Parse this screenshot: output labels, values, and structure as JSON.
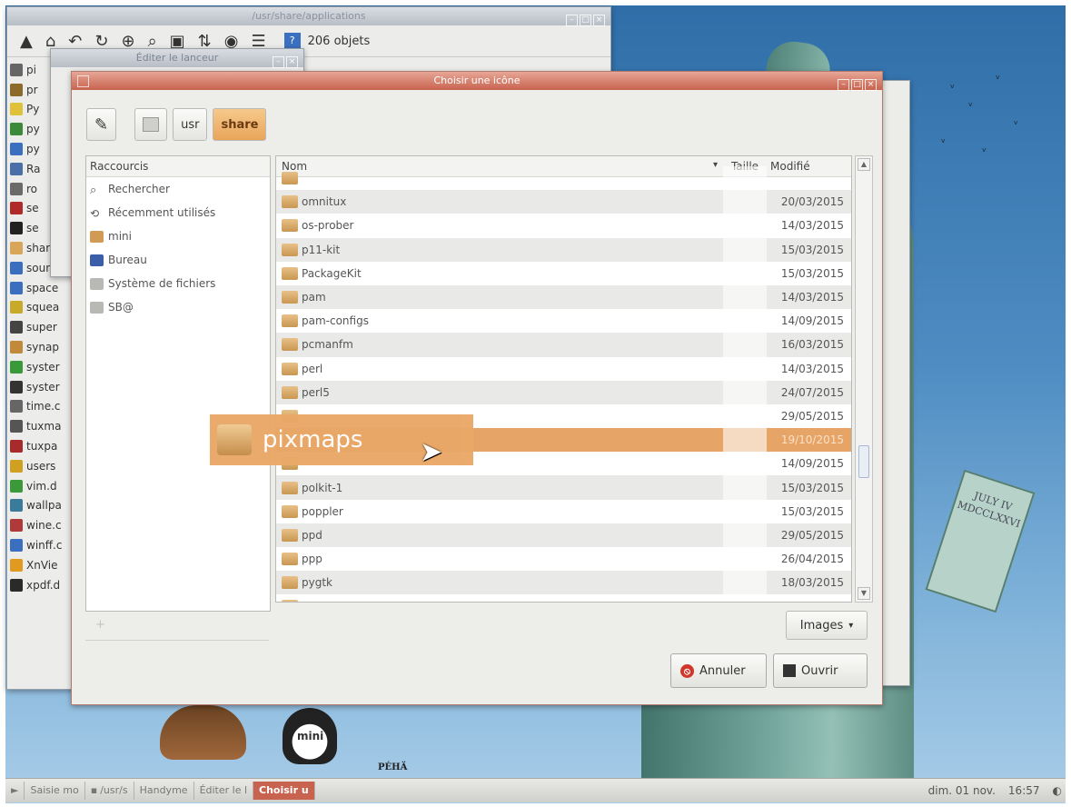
{
  "file_manager": {
    "title": "/usr/share/applications",
    "count_badge": "?",
    "count": "206 objets",
    "items": [
      {
        "label": "pi",
        "color": "#666"
      },
      {
        "label": "pr",
        "color": "#8b6a2a"
      },
      {
        "label": "Py",
        "color": "#e0c23a"
      },
      {
        "label": "py",
        "color": "#3a8a3a"
      },
      {
        "label": "py",
        "color": "#3a6fc0"
      },
      {
        "label": "Ra",
        "color": "#4a6ea8"
      },
      {
        "label": "ro",
        "color": "#6a6a6a"
      },
      {
        "label": "se",
        "color": "#b02a2a"
      },
      {
        "label": "se",
        "color": "#222"
      },
      {
        "label": "share",
        "color": "#d8a55a"
      },
      {
        "label": "sounc",
        "color": "#3a6fc0"
      },
      {
        "label": "space",
        "color": "#3a6fc0"
      },
      {
        "label": "squea",
        "color": "#c9a92a"
      },
      {
        "label": "super",
        "color": "#444"
      },
      {
        "label": "synap",
        "color": "#c08a3a"
      },
      {
        "label": "syster",
        "color": "#3a9a3a"
      },
      {
        "label": "syster",
        "color": "#333"
      },
      {
        "label": "time.c",
        "color": "#666"
      },
      {
        "label": "tuxma",
        "color": "#555"
      },
      {
        "label": "tuxpa",
        "color": "#a82a2a"
      },
      {
        "label": "users",
        "color": "#d0a020"
      },
      {
        "label": "vim.d",
        "color": "#3a9a3a"
      },
      {
        "label": "wallpa",
        "color": "#3a7a9a"
      },
      {
        "label": "wine.c",
        "color": "#b03a3a"
      },
      {
        "label": "winff.c",
        "color": "#3a6fc0"
      },
      {
        "label": "XnVie",
        "color": "#e09a20"
      },
      {
        "label": "xpdf.d",
        "color": "#2a2a2a"
      }
    ]
  },
  "launcher_editor": {
    "title": "Éditer le lanceur"
  },
  "dialog": {
    "title": "Choisir une icône",
    "path": [
      "usr",
      "share"
    ],
    "places_header": "Raccourcis",
    "places": [
      {
        "label": "Rechercher",
        "icon": "search-icon",
        "color": "#555"
      },
      {
        "label": "Récemment utilisés",
        "icon": "clock-icon",
        "color": "#555"
      },
      {
        "label": "mini",
        "icon": "home-folder-icon",
        "color": "#d19a55"
      },
      {
        "label": "Bureau",
        "icon": "desktop-icon",
        "color": "#3a5fa8"
      },
      {
        "label": "Système de fichiers",
        "icon": "drive-icon",
        "color": "#b8b8b4"
      },
      {
        "label": "SB@",
        "icon": "drive-icon",
        "color": "#b8b8b4"
      }
    ],
    "columns": {
      "name": "Nom",
      "size": "Taille",
      "modified": "Modifié"
    },
    "files": [
      {
        "name": "",
        "date": ""
      },
      {
        "name": "omnitux",
        "date": "20/03/2015"
      },
      {
        "name": "os-prober",
        "date": "14/03/2015"
      },
      {
        "name": "p11-kit",
        "date": "15/03/2015"
      },
      {
        "name": "PackageKit",
        "date": "15/03/2015"
      },
      {
        "name": "pam",
        "date": "14/03/2015"
      },
      {
        "name": "pam-configs",
        "date": "14/09/2015"
      },
      {
        "name": "pcmanfm",
        "date": "16/03/2015"
      },
      {
        "name": "perl",
        "date": "14/03/2015"
      },
      {
        "name": "perl5",
        "date": "24/07/2015"
      },
      {
        "name": "",
        "date": "29/05/2015"
      },
      {
        "name": "pixmaps",
        "date": "19/10/2015",
        "selected": true
      },
      {
        "name": "",
        "date": "14/09/2015"
      },
      {
        "name": "polkit-1",
        "date": "15/03/2015"
      },
      {
        "name": "poppler",
        "date": "15/03/2015"
      },
      {
        "name": "ppd",
        "date": "29/05/2015"
      },
      {
        "name": "ppp",
        "date": "26/04/2015"
      },
      {
        "name": "pygtk",
        "date": "18/03/2015"
      },
      {
        "name": "",
        "date": ""
      }
    ],
    "dragged_item": "pixmaps",
    "add_symbol": "+",
    "filter": "Images",
    "cancel_label": "Annuler",
    "open_label": "Ouvrir"
  },
  "desktop": {
    "logo": "PÉHÄ",
    "tablet_text": "JULY IV MDCCLXXVI",
    "mascot_label": "mini"
  },
  "taskbar": {
    "tasks": [
      {
        "label": "Saisie mo",
        "active": false
      },
      {
        "label": "/usr/s",
        "active": false
      },
      {
        "label": "Handyme",
        "active": false
      },
      {
        "label": "Éditer le l",
        "active": false
      },
      {
        "label": "Choisir u",
        "active": true
      }
    ],
    "clock_date": "dim. 01 nov.",
    "clock_time": "16:57"
  }
}
